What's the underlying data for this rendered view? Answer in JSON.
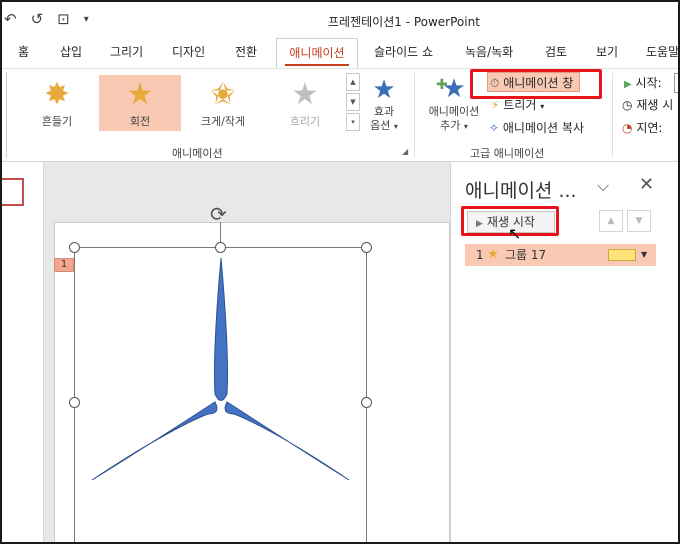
{
  "window": {
    "title": "프레젠테이션1  -  PowerPoint"
  },
  "quick_access": {
    "icons": [
      "undo-icon",
      "redo-icon",
      "start-from-beginning-icon",
      "customize-qat-icon"
    ]
  },
  "tabs": [
    {
      "label": "홈"
    },
    {
      "label": "삽입"
    },
    {
      "label": "그리기"
    },
    {
      "label": "디자인"
    },
    {
      "label": "전환"
    },
    {
      "label": "애니메이션",
      "active": true
    },
    {
      "label": "슬라이드 쇼"
    },
    {
      "label": "녹음/녹화"
    },
    {
      "label": "검토"
    },
    {
      "label": "보기"
    },
    {
      "label": "도움말"
    }
  ],
  "ribbon": {
    "gallery": [
      {
        "label": "흔들기",
        "icon": "teeter-star-icon",
        "color": "#E6A93A"
      },
      {
        "label": "회전",
        "icon": "spin-star-icon",
        "color": "#E6A93A",
        "selected": true
      },
      {
        "label": "크게/작게",
        "icon": "grow-shrink-star-icon",
        "color": "#E6A93A"
      },
      {
        "label": "흐리기",
        "icon": "desaturate-star-icon",
        "color": "#BFBFBF",
        "disabled": true
      }
    ],
    "effect_options": {
      "line1": "효과",
      "line2": "옵션"
    },
    "group_animation_label": "애니메이션",
    "add_animation": {
      "line1": "애니메이션",
      "line2": "추가"
    },
    "animation_pane_btn": "애니메이션 창",
    "trigger_btn": "트리거",
    "animation_painter_btn": "애니메이션 복사",
    "group_advanced_label": "고급 애니메이션",
    "timing": {
      "start_label": "시작:",
      "duration_label": "재생 시",
      "delay_label": "지연:"
    }
  },
  "pane": {
    "title": "애니메이션 ...",
    "play_label": "재생 시작",
    "items": [
      {
        "number": "1",
        "name": "그룹 17"
      }
    ]
  },
  "slide": {
    "anim_tag": "1"
  },
  "colors": {
    "accent": "#C43E1C",
    "highlight": "#F9C9B4",
    "callout_red": "#E8141B",
    "shape_blue": "#4472C4"
  }
}
